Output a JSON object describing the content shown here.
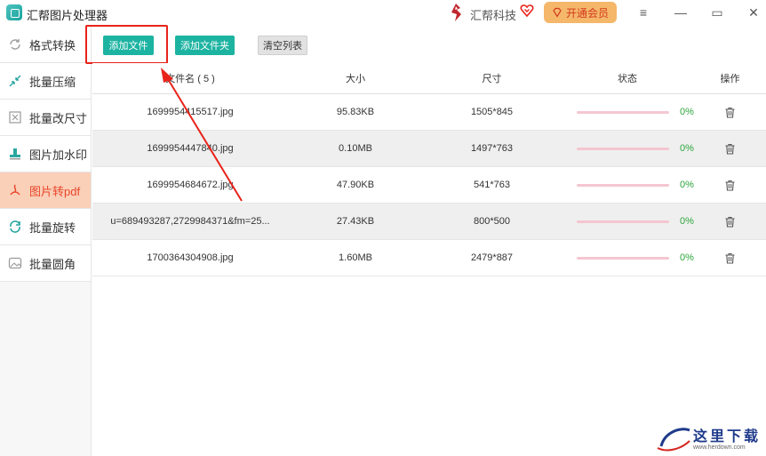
{
  "app": {
    "title": "汇帮图片处理器",
    "brand": "汇帮科技",
    "vip_label": "开通会员",
    "menu_glyph": "≡",
    "minimize_glyph": "—",
    "maximize_glyph": "▭",
    "close_glyph": "✕"
  },
  "sidebar": {
    "items": [
      {
        "label": "格式转换",
        "icon": "refresh-format-icon",
        "active": false
      },
      {
        "label": "批量压缩",
        "icon": "compress-arrows-icon",
        "active": false
      },
      {
        "label": "批量改尺寸",
        "icon": "resize-icon",
        "active": false
      },
      {
        "label": "图片加水印",
        "icon": "stamp-icon",
        "active": false
      },
      {
        "label": "图片转pdf",
        "icon": "pdf-icon",
        "active": true
      },
      {
        "label": "批量旋转",
        "icon": "rotate-icon",
        "active": false
      },
      {
        "label": "批量圆角",
        "icon": "rounded-corner-image-icon",
        "active": false
      }
    ]
  },
  "toolbar": {
    "add_file": "添加文件",
    "add_folder": "添加文件夹",
    "clear_list": "清空列表"
  },
  "table": {
    "headers": {
      "name": "文件名 ( 5 )",
      "size": "大小",
      "dim": "尺寸",
      "status": "状态",
      "op": "操作"
    },
    "rows": [
      {
        "name": "1699954415517.jpg",
        "size": "95.83KB",
        "dim": "1505*845",
        "progress": "0%"
      },
      {
        "name": "1699954447840.jpg",
        "size": "0.10MB",
        "dim": "1497*763",
        "progress": "0%"
      },
      {
        "name": "1699954684672.jpg",
        "size": "47.90KB",
        "dim": "541*763",
        "progress": "0%"
      },
      {
        "name": "u=689493287,2729984371&fm=25...",
        "size": "27.43KB",
        "dim": "800*500",
        "progress": "0%"
      },
      {
        "name": "1700364304908.jpg",
        "size": "1.60MB",
        "dim": "2479*887",
        "progress": "0%"
      }
    ]
  },
  "watermark": {
    "text": "这里下载",
    "sub": "www.herdown.com"
  },
  "colors": {
    "accent_teal": "#1cb3a1",
    "active_bg": "#fad0b8",
    "active_text": "#e8462a",
    "highlight_red": "#e8231a",
    "progress_green": "#2da53a"
  }
}
